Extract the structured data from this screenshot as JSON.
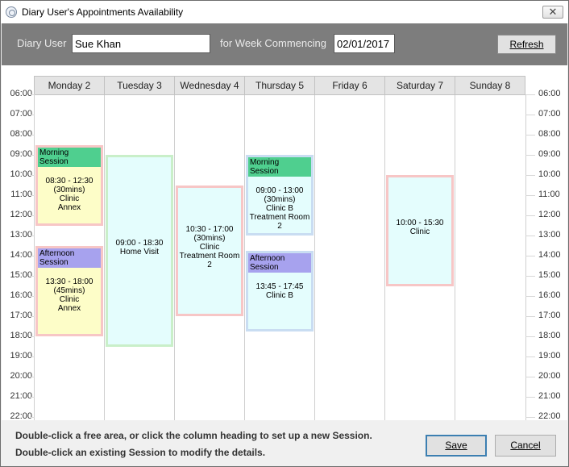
{
  "window": {
    "title": "Diary User's Appointments Availability"
  },
  "header": {
    "user_label": "Diary User",
    "user_value": "Sue Khan",
    "week_label": "for Week Commencing",
    "week_value": "02/01/2017",
    "refresh_label": "Refresh"
  },
  "times": [
    "06:00",
    "07:00",
    "08:00",
    "09:00",
    "10:00",
    "11:00",
    "12:00",
    "13:00",
    "14:00",
    "15:00",
    "16:00",
    "17:00",
    "18:00",
    "19:00",
    "20:00",
    "21:00",
    "22:00"
  ],
  "days": [
    "Monday 2",
    "Tuesday 3",
    "Wednesday 4",
    "Thursday 5",
    "Friday 6",
    "Saturday 7",
    "Sunday 8"
  ],
  "sessions": [
    {
      "day": 0,
      "start": 8.5,
      "end": 12.5,
      "title": "Morning Session",
      "lines": [
        "08:30 - 12:30",
        "(30mins)",
        "Clinic",
        "Annex"
      ],
      "bg": "#fdfdc8",
      "border": "#f7c6c6",
      "title_bg": "#4fcf8f"
    },
    {
      "day": 0,
      "start": 13.5,
      "end": 18.0,
      "title": "Afternoon Session",
      "lines": [
        "13:30 - 18:00",
        "(45mins)",
        "Clinic",
        "Annex"
      ],
      "bg": "#fdfdc8",
      "border": "#f7c6c6",
      "title_bg": "#a7a2ee"
    },
    {
      "day": 1,
      "start": 9.0,
      "end": 18.5,
      "title": "",
      "lines": [
        "09:00 - 18:30",
        "Home Visit"
      ],
      "bg": "#e4fdfd",
      "border": "#c9efc9",
      "title_bg": ""
    },
    {
      "day": 2,
      "start": 10.5,
      "end": 17.0,
      "title": "",
      "lines": [
        "10:30 - 17:00",
        "(30mins)",
        "Clinic",
        "Treatment Room 2"
      ],
      "bg": "#e4fdfd",
      "border": "#f7c6c6",
      "title_bg": ""
    },
    {
      "day": 3,
      "start": 9.0,
      "end": 13.0,
      "title": "Morning Session",
      "lines": [
        "09:00 - 13:00",
        "(30mins)",
        "Clinic B",
        "Treatment Room 2"
      ],
      "bg": "#e4fdfd",
      "border": "#c9ddf2",
      "title_bg": "#4fcf8f"
    },
    {
      "day": 3,
      "start": 13.75,
      "end": 17.75,
      "title": "Afternoon Session",
      "lines": [
        "13:45 - 17:45",
        "Clinic B"
      ],
      "bg": "#e4fdfd",
      "border": "#c9ddf2",
      "title_bg": "#a7a2ee"
    },
    {
      "day": 5,
      "start": 10.0,
      "end": 15.5,
      "title": "",
      "lines": [
        "10:00 - 15:30",
        "Clinic"
      ],
      "bg": "#e4fdfd",
      "border": "#f7c6c6",
      "title_bg": ""
    }
  ],
  "footer": {
    "hint1": "Double-click a free area, or click the column heading to set up a new Session.",
    "hint2": "Double-click an existing Session to modify  the details.",
    "save_label": "Save",
    "cancel_label": "Cancel"
  }
}
